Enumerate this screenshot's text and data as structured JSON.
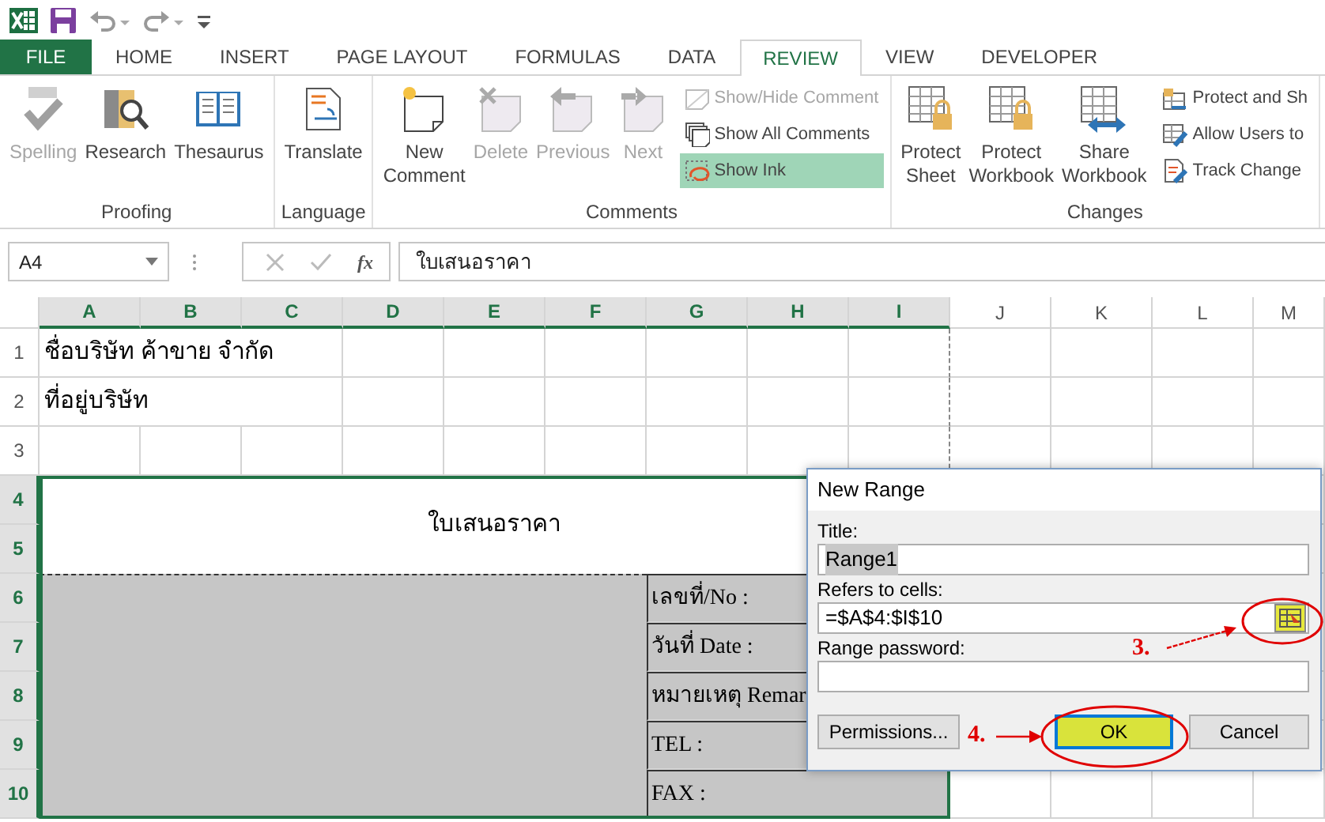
{
  "tabs": [
    {
      "label": "FILE",
      "kind": "file",
      "selected": false
    },
    {
      "label": "HOME",
      "kind": "tab",
      "selected": false
    },
    {
      "label": "INSERT",
      "kind": "tab",
      "selected": false
    },
    {
      "label": "PAGE LAYOUT",
      "kind": "tab",
      "selected": false
    },
    {
      "label": "FORMULAS",
      "kind": "tab",
      "selected": false
    },
    {
      "label": "DATA",
      "kind": "tab",
      "selected": false
    },
    {
      "label": "REVIEW",
      "kind": "tab",
      "selected": true
    },
    {
      "label": "VIEW",
      "kind": "tab",
      "selected": false
    },
    {
      "label": "DEVELOPER",
      "kind": "tab",
      "selected": false
    }
  ],
  "ribbon_groups": [
    {
      "label": "Proofing",
      "buttons": [
        {
          "kind": "large",
          "label": "Spelling",
          "disabled": true
        },
        {
          "kind": "large",
          "label": "Research",
          "disabled": false
        },
        {
          "kind": "large",
          "label": "Thesaurus",
          "disabled": false
        }
      ]
    },
    {
      "label": "Language",
      "buttons": [
        {
          "kind": "large",
          "label": "Translate",
          "disabled": false
        }
      ]
    },
    {
      "label": "Comments",
      "buttons": [
        {
          "kind": "large",
          "label": "New Comment",
          "disabled": false
        },
        {
          "kind": "large",
          "label": "Delete",
          "disabled": true
        },
        {
          "kind": "large",
          "label": "Previous",
          "disabled": true
        },
        {
          "kind": "large",
          "label": "Next",
          "disabled": true
        },
        {
          "kind": "small",
          "label": "Show/Hide Comment",
          "disabled": true,
          "highlighted": false
        },
        {
          "kind": "small",
          "label": "Show All Comments",
          "disabled": false,
          "highlighted": false
        },
        {
          "kind": "small",
          "label": "Show Ink",
          "disabled": false,
          "highlighted": true
        }
      ]
    },
    {
      "label": "Changes",
      "buttons": [
        {
          "kind": "large",
          "label": "Protect Sheet",
          "disabled": false
        },
        {
          "kind": "large",
          "label": "Protect Workbook",
          "disabled": false
        },
        {
          "kind": "large",
          "label": "Share Workbook",
          "disabled": false
        },
        {
          "kind": "small",
          "label": "Protect and Sh",
          "disabled": false,
          "highlighted": false
        },
        {
          "kind": "small",
          "label": "Allow Users to",
          "disabled": false,
          "highlighted": false
        },
        {
          "kind": "small",
          "label": "Track Change",
          "disabled": false,
          "highlighted": false
        }
      ]
    }
  ],
  "formula_bar": {
    "name_box": "A4",
    "function_symbol": "fx",
    "formula": "ใบเสนอราคา"
  },
  "columns": [
    {
      "label": "A",
      "selected": true
    },
    {
      "label": "B",
      "selected": true
    },
    {
      "label": "C",
      "selected": true
    },
    {
      "label": "D",
      "selected": true
    },
    {
      "label": "E",
      "selected": true
    },
    {
      "label": "F",
      "selected": true
    },
    {
      "label": "G",
      "selected": true
    },
    {
      "label": "H",
      "selected": true
    },
    {
      "label": "I",
      "selected": true
    },
    {
      "label": "J",
      "selected": false
    },
    {
      "label": "K",
      "selected": false
    },
    {
      "label": "L",
      "selected": false
    },
    {
      "label": "M",
      "selected": false
    }
  ],
  "rows": [
    {
      "label": "1",
      "selected": false,
      "kind": "plain",
      "text": "ชื่อบริษัท ค้าขาย จำกัด"
    },
    {
      "label": "2",
      "selected": false,
      "kind": "plain",
      "text": "ที่อยู่บริษัท"
    },
    {
      "label": "3",
      "selected": false,
      "kind": "plain"
    },
    {
      "label": "4",
      "selected": true,
      "kind": "title",
      "text": "ใบเสนอราคา"
    },
    {
      "label": "5",
      "selected": true,
      "kind": "title_cont"
    },
    {
      "label": "6",
      "selected": true,
      "kind": "form",
      "text": "เลขที่/No :"
    },
    {
      "label": "7",
      "selected": true,
      "kind": "form",
      "text": "วันที่ Date :"
    },
    {
      "label": "8",
      "selected": true,
      "kind": "form",
      "text": "หมายเหตุ Remar"
    },
    {
      "label": "9",
      "selected": true,
      "kind": "form",
      "text": "TEL :"
    },
    {
      "label": "10",
      "selected": true,
      "kind": "form",
      "text": "FAX :"
    }
  ],
  "dialog": {
    "title": "New Range",
    "fields": [
      {
        "label": "Title:",
        "kind": "text",
        "value": "Range1",
        "value_selected": true
      },
      {
        "label": "Refers to cells:",
        "kind": "range",
        "value": "=$A$4:$I$10",
        "button_highlighted": true
      },
      {
        "label": "Range password:",
        "kind": "text"
      }
    ],
    "buttons": [
      {
        "label": "Permissions...",
        "default": false,
        "highlighted": false
      },
      {
        "label": "OK",
        "default": true,
        "highlighted": true
      },
      {
        "label": "Cancel",
        "default": false,
        "highlighted": false
      }
    ]
  },
  "annotations": [
    {
      "label": "3."
    },
    {
      "label": "4."
    }
  ]
}
